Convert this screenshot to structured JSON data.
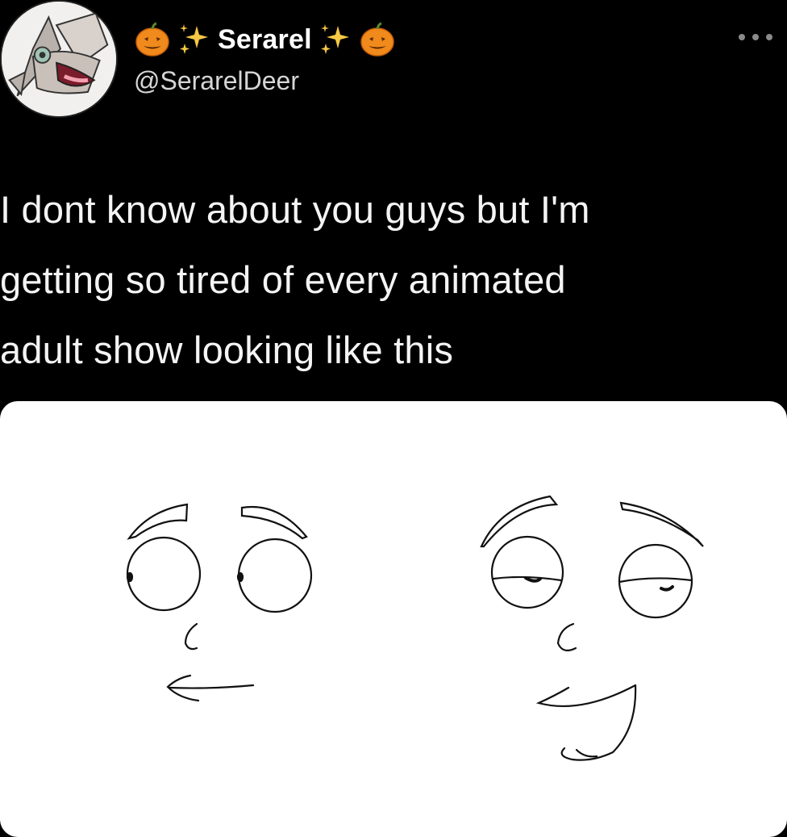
{
  "author": {
    "display_name": "Serarel",
    "handle": "@SerarelDeer",
    "name_decorations": [
      "pumpkin-icon",
      "sparkles-icon"
    ]
  },
  "tweet": {
    "text": "I dont know about you guys but I'm\ngetting so tired of every animated\nadult show looking like this"
  },
  "media": {
    "description_icon": "cartoon-faces-drawing"
  },
  "colors": {
    "background": "#000000",
    "text": "#f4f4f4",
    "handle": "#d6d6d6",
    "media_bg": "#ffffff"
  }
}
